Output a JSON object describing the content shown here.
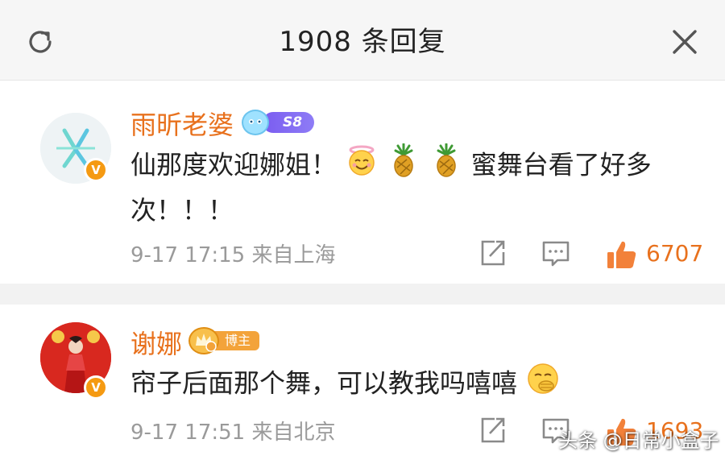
{
  "header": {
    "title": "1908 条回复",
    "refresh_icon": "refresh-icon",
    "close_icon": "close-icon"
  },
  "comments": [
    {
      "username": "雨昕老婆",
      "badge_text": "S8",
      "verified_mark": "V",
      "content_parts": [
        "仙那度欢迎娜姐！",
        "蜜舞台看了好多",
        "次！！！"
      ],
      "emoji_icons": [
        "smiling-angel-emoji",
        "pineapple-emoji",
        "pineapple-emoji"
      ],
      "timestamp": "9-17 17:15",
      "location": "来自上海",
      "like_count": "6707"
    },
    {
      "username": "谢娜",
      "badge_text": "博主",
      "verified_mark": "V",
      "content_parts": [
        "帘子后面那个舞，可以教我吗嘻嘻"
      ],
      "emoji_icons": [
        "giggle-emoji"
      ],
      "timestamp": "9-17 17:51",
      "location": "来自北京",
      "like_count": "1693"
    }
  ],
  "watermark": "头条 @日常小盒子",
  "colors": {
    "accent_orange": "#e8711d",
    "meta_gray": "#9a9a9a",
    "level_purple": "#7a5cf0",
    "blogger_gold": "#f3a33a"
  }
}
